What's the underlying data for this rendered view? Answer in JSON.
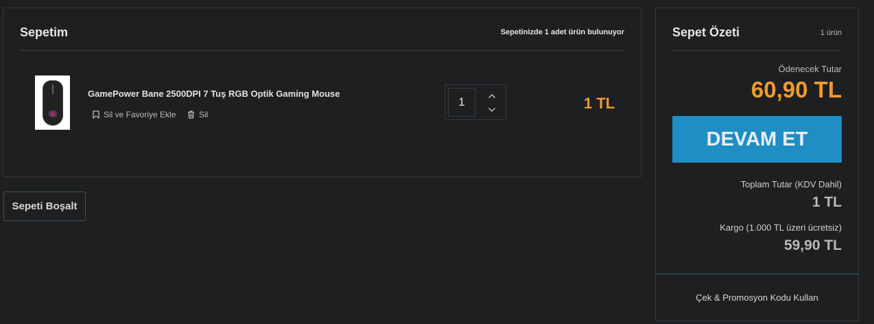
{
  "cart": {
    "title": "Sepetim",
    "count_prefix": "Sepetinizde ",
    "count_value": "1",
    "count_suffix": " adet ürün bulunuyor",
    "item": {
      "name": "GamePower Bane 2500DPI 7 Tuş RGB Optik Gaming Mouse",
      "remove_and_favorite_label": "Sil ve Favoriye Ekle",
      "remove_label": "Sil",
      "quantity": "1",
      "price": "1 TL",
      "image_icon": "mouse-product-image"
    },
    "empty_button_label": "Sepeti Boşalt"
  },
  "summary": {
    "title": "Sepet Özeti",
    "count": "1 ürün",
    "payable_label": "Ödenecek Tutar",
    "payable_value": "60,90 TL",
    "continue_label": "DEVAM ET",
    "total_label": "Toplam Tutar (KDV Dahil)",
    "total_value": "1 TL",
    "shipping_label": "Kargo (1.000 TL üzeri ücretsiz)",
    "shipping_value": "59,90 TL",
    "promo_label": "Çek & Promosyon Kodu Kullan"
  },
  "colors": {
    "accent_price": "#f29a2e",
    "primary_button": "#1f8ec4",
    "background": "#1d1f21"
  }
}
